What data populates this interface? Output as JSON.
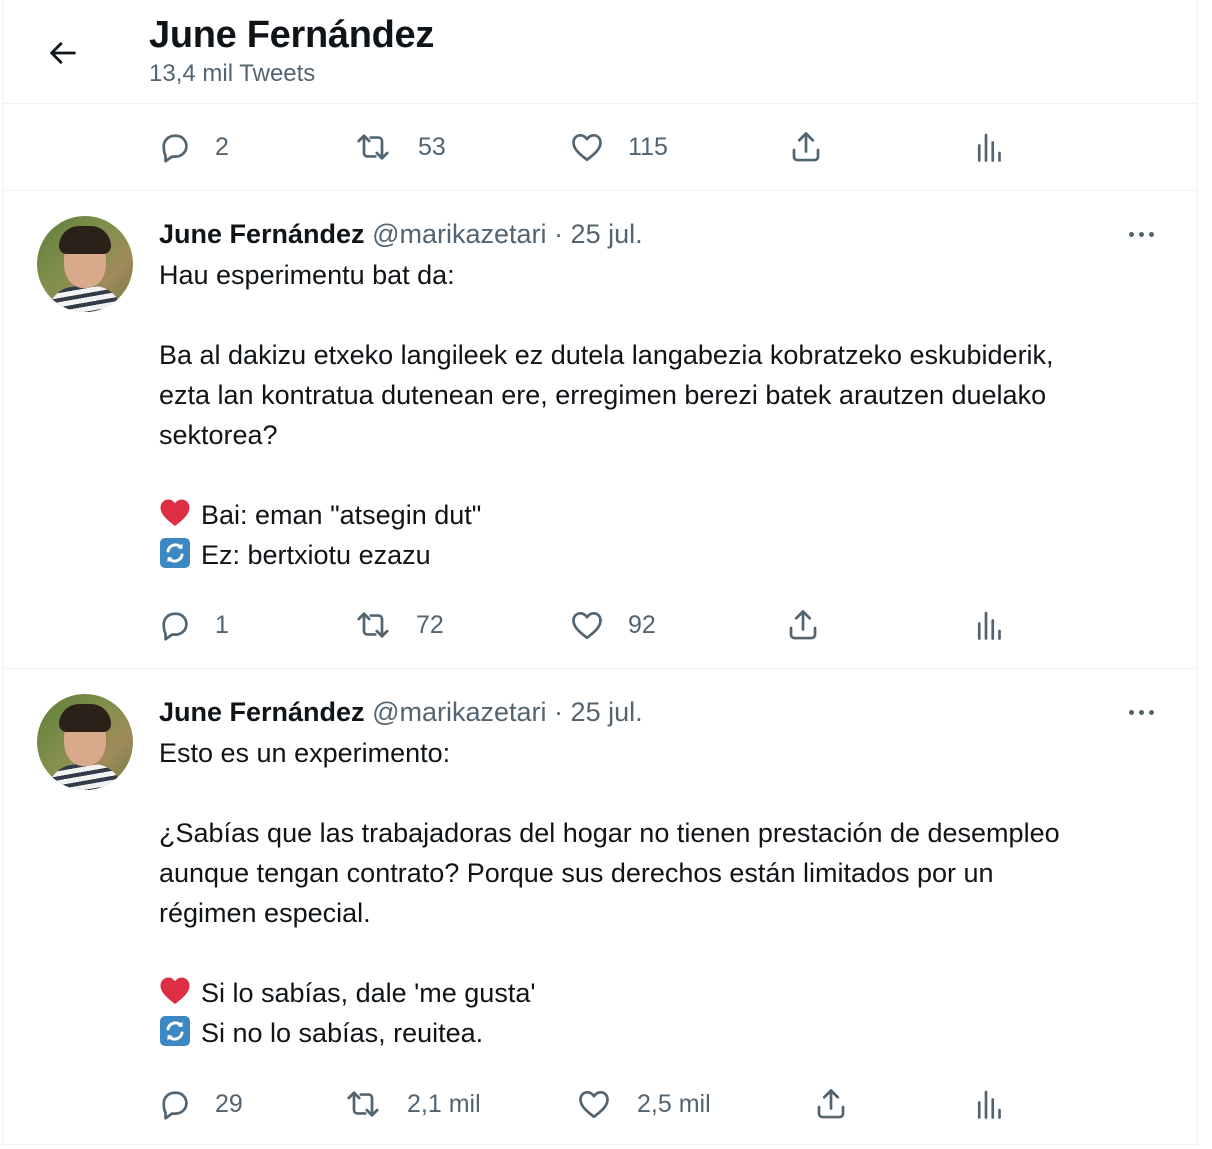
{
  "header": {
    "title": "June Fernández",
    "subtitle": "13,4 mil Tweets"
  },
  "top_actions": {
    "replies": "2",
    "retweets": "53",
    "likes": "115"
  },
  "tweets": [
    {
      "name": "June Fernández",
      "handle": "@marikazetari",
      "separator": "·",
      "date": "25 jul.",
      "line1": "Hau esperimentu bat da:",
      "para_a": "Ba al dakizu etxeko langileek ez dutela langabezia kobratzeko eskubiderik,",
      "para_b": "ezta lan kontratua dutenean ere, erregimen berezi batek arautzen duelako",
      "para_c": "sektorea?",
      "opt1": "Bai: eman \"atsegin dut\"",
      "opt2": "Ez: bertxiotu ezazu",
      "replies": "1",
      "retweets": "72",
      "likes": "92"
    },
    {
      "name": "June Fernández",
      "handle": "@marikazetari",
      "separator": "·",
      "date": "25 jul.",
      "line1": "Esto es un experimento:",
      "para_a": "¿Sabías que las trabajadoras del hogar no tienen prestación de desempleo",
      "para_b": "aunque tengan contrato? Porque sus derechos están limitados por un",
      "para_c": "régimen especial.",
      "opt1": "Si lo sabías, dale 'me gusta'",
      "opt2": "Si no lo sabías, reuitea.",
      "replies": "29",
      "retweets": "2,1 mil",
      "likes": "2,5 mil"
    }
  ],
  "icons": {
    "back": "arrow-left-icon",
    "reply": "speech-bubble-icon",
    "retweet": "retweet-arrows-icon",
    "like": "heart-icon",
    "share": "share-upload-icon",
    "analytics": "bar-chart-icon",
    "more": "ellipsis-icon",
    "emoji1": "red-heart-emoji",
    "emoji2": "counterclockwise-arrows-emoji"
  },
  "colors": {
    "text": "#0f1419",
    "secondary": "#536471",
    "border": "#eff3f4",
    "heart_emoji": "#e0245e",
    "arrows_emoji": "#3b88c3"
  }
}
